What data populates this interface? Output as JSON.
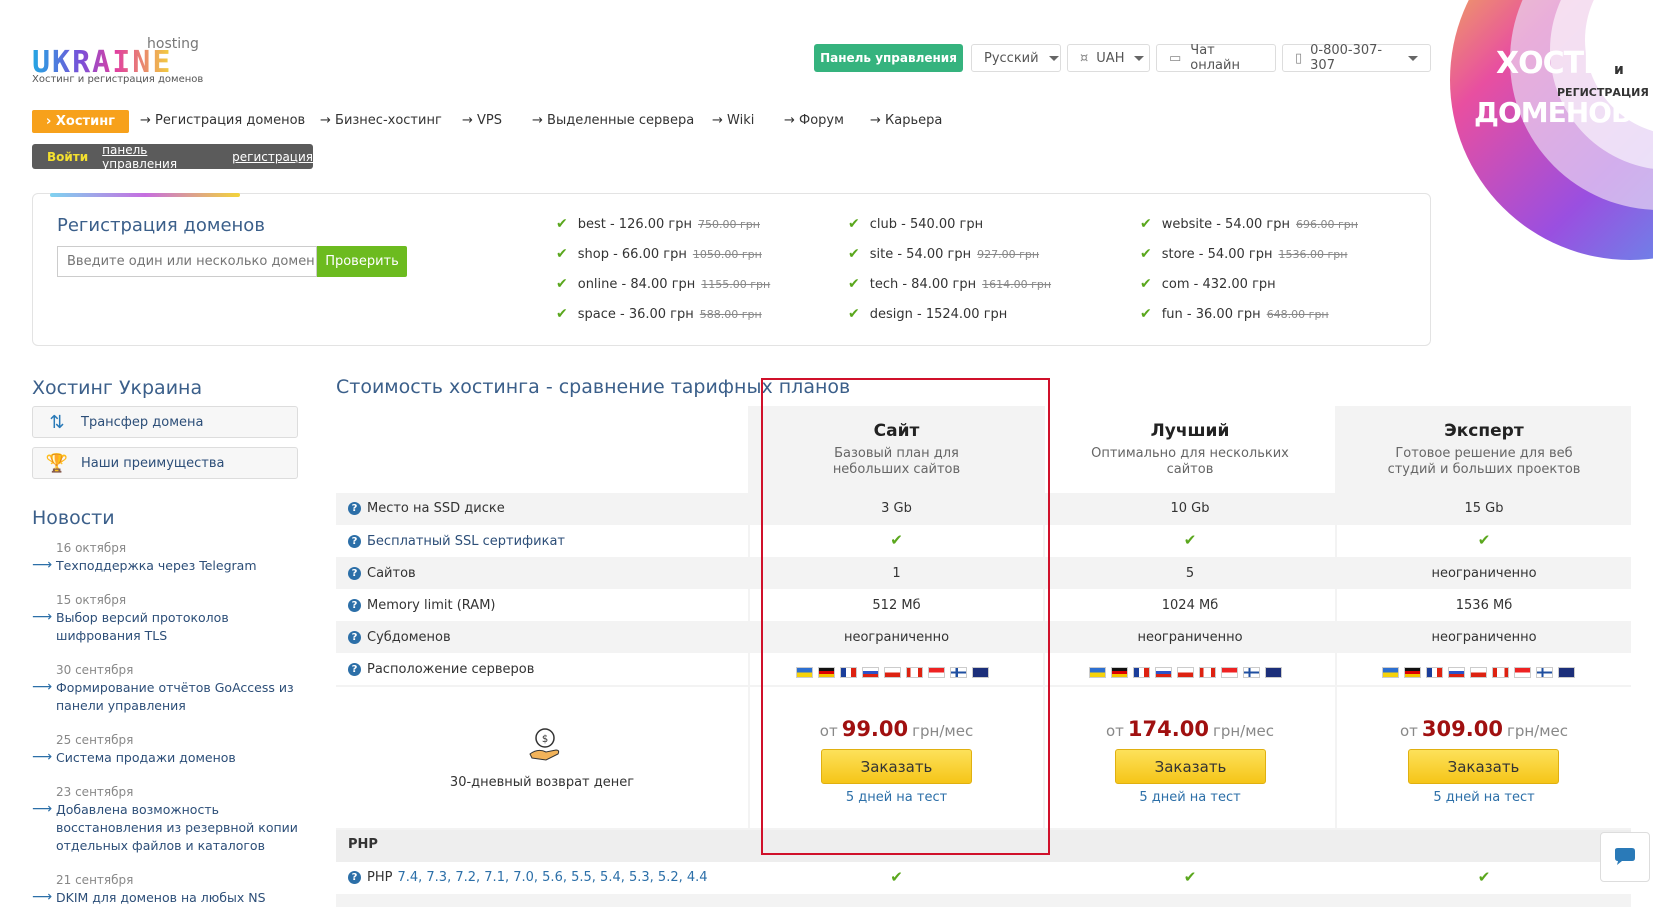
{
  "logo": {
    "word": "UKRAINE",
    "hosting": "hosting",
    "tagline": "Хостинг и регистрация доменов"
  },
  "topbar": {
    "panel": "Панель управления",
    "language": "Русский",
    "currency": "UAH",
    "chat": "Чат онлайн",
    "phone": "0-800-307-307"
  },
  "nav": {
    "active": "› Хостинг",
    "items": [
      "→ Регистрация доменов",
      "→ Бизнес-хостинг",
      "→ VPS",
      "→ Выделенные сервера",
      "→ Wiki",
      "→ Форум",
      "→ Карьера"
    ]
  },
  "loginbar": {
    "login": "Войти",
    "panel": "панель управления",
    "register": "регистрация"
  },
  "domains": {
    "title": "Регистрация доменов",
    "placeholder": "Введите один или несколько доменов",
    "check": "Проверить",
    "zones": [
      {
        "text": "best - 126.00 грн",
        "old": "750.00 грн"
      },
      {
        "text": "shop - 66.00 грн",
        "old": "1050.00 грн"
      },
      {
        "text": "online - 84.00 грн",
        "old": "1155.00 грн"
      },
      {
        "text": "space - 36.00 грн",
        "old": "588.00 грн"
      },
      {
        "text": "club - 540.00 грн",
        "old": ""
      },
      {
        "text": "site - 54.00 грн",
        "old": "927.00 грн"
      },
      {
        "text": "tech - 84.00 грн",
        "old": "1614.00 грн"
      },
      {
        "text": "design - 1524.00 грн",
        "old": ""
      },
      {
        "text": "website - 54.00 грн",
        "old": "696.00 грн"
      },
      {
        "text": "store - 54.00 грн",
        "old": "1536.00 грн"
      },
      {
        "text": "com - 432.00 грн",
        "old": ""
      },
      {
        "text": "fun - 36.00 грн",
        "old": "648.00 грн"
      }
    ]
  },
  "promo": {
    "line1": "ХОСТИНГ",
    "and": "и",
    "line2": "РЕГИСТРАЦИЯ",
    "line3": "ДОМЕНОВ"
  },
  "sidebar": {
    "title": "Хостинг Украина",
    "buttons": [
      "Трансфер домена",
      "Наши преимущества"
    ],
    "news_title": "Новости",
    "news": [
      {
        "date": "16 октября",
        "text": "Техподдержка через Telegram"
      },
      {
        "date": "15 октября",
        "text": "Выбор версий протоколов шифрования TLS"
      },
      {
        "date": "30 сентября",
        "text": "Формирование отчётов GoAccess из панели управления"
      },
      {
        "date": "25 сентября",
        "text": "Система продажи доменов"
      },
      {
        "date": "23 сентября",
        "text": "Добавлена возможность восстановления из резервной копии отдельных файлов и каталогов"
      },
      {
        "date": "21 сентября",
        "text": "DKIM для доменов на любых NS"
      }
    ]
  },
  "table": {
    "title": "Стоимость хостинга - сравнение тарифных планов",
    "refund": "30-дневный возврат денег",
    "features": [
      "Место на SSD диске",
      "Бесплатный SSL сертификат",
      "Сайтов",
      "Memory limit (RAM)",
      "Субдоменов",
      "Расположение серверов"
    ],
    "php_section": "PHP",
    "php_label": "PHP",
    "php_versions": "7.4, 7.3, 7.2, 7.1, 7.0, 5.6, 5.5, 5.4, 5.3, 5.2, 4.4",
    "price_prefix": "от",
    "price_suffix": "грн/мес",
    "plans": [
      {
        "name": "Сайт",
        "desc": "Базовый план для небольших сайтов",
        "disk": "3 Gb",
        "sites": "1",
        "ram": "512 Мб",
        "subdomains": "неограниченно",
        "price": "99.00",
        "order": "Заказать",
        "trial": "5 дней на тест"
      },
      {
        "name": "Лучший",
        "desc": "Оптимально для нескольких сайтов",
        "disk": "10 Gb",
        "sites": "5",
        "ram": "1024 Мб",
        "subdomains": "неограниченно",
        "price": "174.00",
        "order": "Заказать",
        "trial": "5 дней на тест"
      },
      {
        "name": "Эксперт",
        "desc": "Готовое решение для веб студий и больших проектов",
        "disk": "15 Gb",
        "sites": "неограниченно",
        "ram": "1536 Мб",
        "subdomains": "неограниченно",
        "price": "309.00",
        "order": "Заказать",
        "trial": "5 дней на тест"
      }
    ]
  },
  "colors": {
    "accent": "#f7a11b",
    "green": "#35b37e",
    "check": "#6cbb1f",
    "price": "#a01010",
    "frame": "#d0102a"
  }
}
